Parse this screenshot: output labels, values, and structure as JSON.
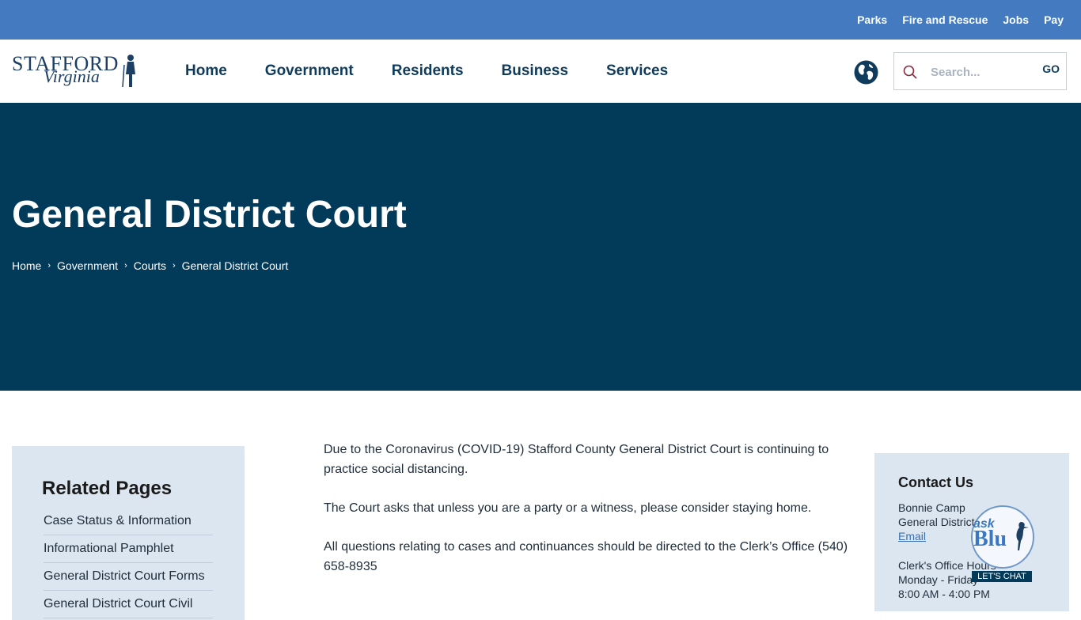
{
  "topbar": {
    "links": [
      "Parks",
      "Fire and Rescue",
      "Jobs",
      "Pay"
    ]
  },
  "logo": {
    "line1": "STAFFORD",
    "line2": "Virginia"
  },
  "nav": {
    "items": [
      "Home",
      "Government",
      "Residents",
      "Business",
      "Services"
    ]
  },
  "search": {
    "placeholder": "Search...",
    "go_label": "GO"
  },
  "hero": {
    "title": "General District Court",
    "breadcrumb": [
      "Home",
      "Government",
      "Courts",
      "General District Court"
    ]
  },
  "sidebar": {
    "heading": "Related Pages",
    "items": [
      "Case Status & Information",
      "Informational Pamphlet",
      "General District Court Forms",
      "General District Court Civil"
    ]
  },
  "content": {
    "paragraphs": [
      "Due to the Coronavirus (COVID-19) Stafford County General District Court is continuing to practice social distancing.",
      "The Court asks that unless you are a party or a witness, please consider staying home.",
      "All questions relating to cases and continuances should be directed to the Clerk’s Office (540) 658-8935"
    ]
  },
  "contact": {
    "heading": "Contact Us",
    "name": "Bonnie Camp",
    "title": "General District",
    "email_label": "Email",
    "hours_label": "Clerk's Office Hours",
    "days": "Monday - Friday",
    "hours": "8:00 AM - 4:00 PM"
  },
  "chat": {
    "ask": "ask",
    "blu": "Blu",
    "cta": "LET'S CHAT"
  },
  "colors": {
    "topbar": "#437ac0",
    "hero": "#023a5a",
    "nav_text": "#0f3b5c",
    "panel": "#dce6f1"
  }
}
